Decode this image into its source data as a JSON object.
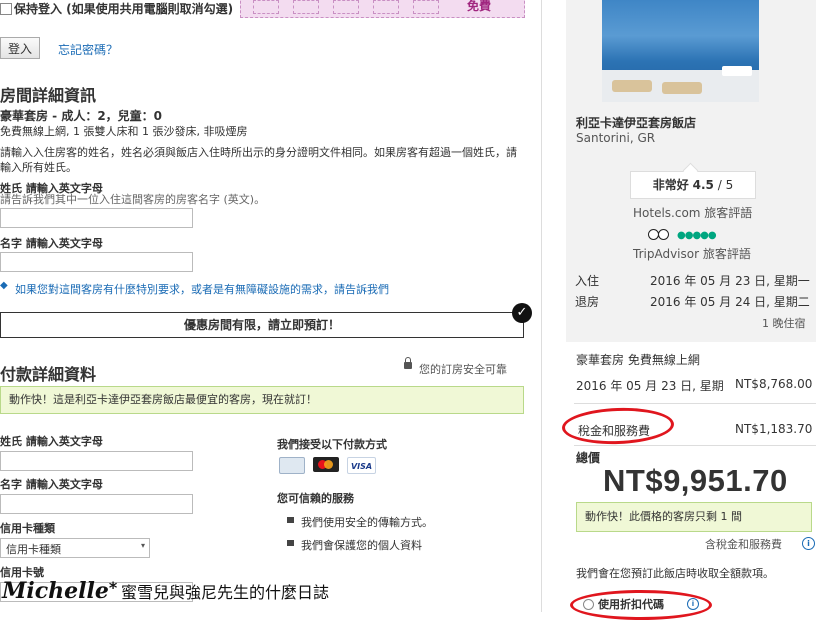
{
  "login": {
    "remember_label": "保持登入 (如果使用共用電腦則取消勾選)",
    "login_button": "登入",
    "forgot_password": "忘記密碼？",
    "bonus_label": "免費"
  },
  "room_details": {
    "heading": "房間詳細資訊",
    "room_summary": "豪華套房 - 成人：2，兒童：0",
    "room_features": "免費無線上網, 1 張雙人床和 1 張沙發床, 非吸煙房",
    "instructions": "請輸入入住房客的姓名，姓名必須與飯店入住時所出示的身分證明文件相同。如果房客有超過一個姓氏，請輸入所有姓氏。",
    "surname_label": "姓氏 請輸入英文字母",
    "surname_hint": "請告訴我們其中一位入住這間客房的房客名字 (英文)。",
    "firstname_label": "名字 請輸入英文字母",
    "special_request_link": "如果您對這間客房有什麼特別要求，或者是有無障礙設施的需求，請告訴我們"
  },
  "urgency_banner": "優惠房間有限，請立即預訂！",
  "payment": {
    "heading": "付款詳細資料",
    "secure_note": "您的訂房安全可靠",
    "best_price_banner": "動作快！這是利亞卡達伊亞套房飯店最便宜的客房，現在就訂！",
    "surname_label": "姓氏 請輸入英文字母",
    "firstname_label": "名字 請輸入英文字母",
    "card_type_label": "信用卡種類",
    "card_type_value": "信用卡種類",
    "card_number_label": "信用卡號",
    "accept_label": "我們接受以下付款方式",
    "card_brands": [
      "VISA"
    ],
    "trust_label": "您可信賴的服務",
    "trust_items": [
      "我們使用安全的傳輸方式。",
      "我們會保護您的個人資料"
    ]
  },
  "watermark": {
    "name": "Michelle",
    "star": "*",
    "text": "蜜雪兒與強尼先生的什麼日誌"
  },
  "hotel": {
    "name": "利亞卡達伊亞套房飯店",
    "location": "Santorini, GR",
    "rating_label": "非常好",
    "rating_value": "4.5",
    "rating_max": "/ 5",
    "hotels_reviews": "Hotels.com 旅客評語",
    "tripadvisor_reviews": "TripAdvisor 旅客評語",
    "checkin_label": "入住",
    "checkin_date": "2016 年 05 月 23 日, 星期一",
    "checkout_label": "退房",
    "checkout_date": "2016 年 05 月 24 日, 星期二",
    "nights": "1 晚住宿"
  },
  "summary": {
    "room_type": "豪華套房 免費無線上網",
    "date_line": "2016 年 05 月 23 日, 星期",
    "room_price": "NT$8,768.00",
    "tax_label": "稅金和服務費",
    "tax_price": "NT$1,183.70",
    "total_label": "總價",
    "total_price": "NT$9,951.70",
    "rooms_left": "動作快！此價格的客房只剩 1 間",
    "tax_included": "含稅金和服務費",
    "charge_note": "我們會在您預訂此飯店時收取全額款項。",
    "coupon_label": "使用折扣代碼"
  },
  "colors": {
    "link": "#1a6bb5",
    "banner_bg": "#f0f8d6",
    "banner_border": "#b9d98a",
    "promo_pink": "#f3dcf0",
    "oval": "#e0161e"
  }
}
